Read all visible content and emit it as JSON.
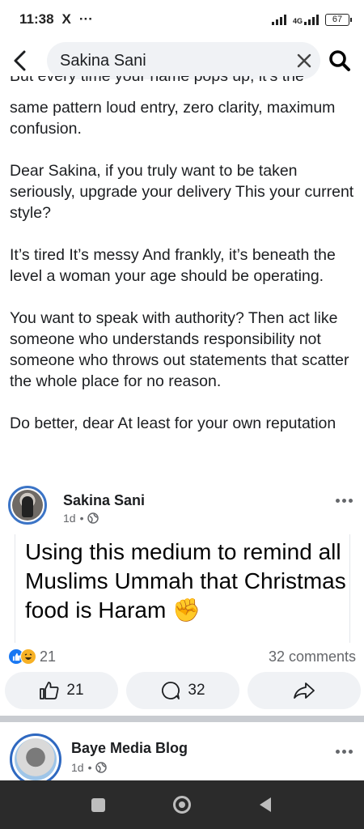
{
  "status_bar": {
    "time": "11:38",
    "x_app_icon": "X",
    "more_dots": "···",
    "network": "4G",
    "battery": "67"
  },
  "search": {
    "query": "Sakina Sani"
  },
  "post": {
    "paragraphs": [
      "But every time your name pops up, it’s the",
      "same pattern loud entry, zero clarity, maximum confusion.",
      "Dear Sakina, if you truly want to be taken seriously, upgrade your delivery This your current style?",
      "It’s tired It’s messy And frankly, it’s beneath the level a woman your age should be operating.",
      "You want to speak with authority? Then act like someone who understands responsibility not someone who throws out statements that scatter the whole place for no reason.",
      "Do better, dear At least for your own reputation"
    ]
  },
  "shared_post": {
    "author": "Sakina Sani",
    "time": "1d",
    "separator": "•",
    "text": "Using this medium to remind all Muslims Ummah that Christmas food is Haram ✊",
    "reaction_count": "21",
    "comments": "32 comments"
  },
  "actions": {
    "like_count": "21",
    "comment_count": "32"
  },
  "next_post": {
    "author": "Baye Media Blog",
    "time": "1d",
    "separator": "•"
  },
  "icons": {
    "back": "chevron-left-icon",
    "clear": "close-icon",
    "search": "search-icon",
    "globe": "globe-icon",
    "like": "thumbs-up-icon",
    "comment": "comment-icon",
    "share": "share-icon"
  },
  "colors": {
    "accent_blue": "#1877f2",
    "secondary_text": "#65676b",
    "pill_bg": "#f0f2f5",
    "nav_bg": "#2b2b2b"
  }
}
